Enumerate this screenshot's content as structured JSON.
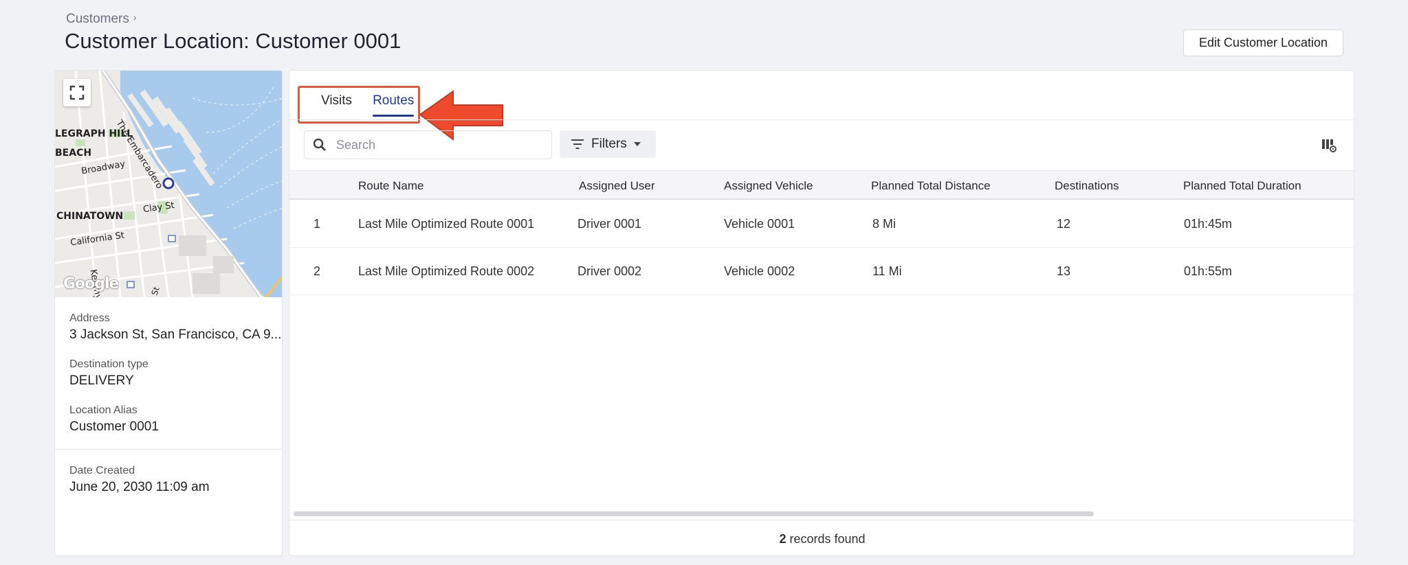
{
  "breadcrumb": {
    "parent": "Customers"
  },
  "page": {
    "title": "Customer Location: Customer 0001",
    "edit_button": "Edit Customer Location"
  },
  "map": {
    "labels": {
      "telegraph_hill": "LEGRAPH HILL",
      "beach": "BEACH",
      "broadway": "Broadway",
      "embarcadero": "The Embarcadero",
      "chinatown": "CHINATOWN",
      "clay_st": "Clay St",
      "california_st": "California St",
      "kearny": "Kearny",
      "st": "St"
    },
    "attribution": "Google",
    "water_color": "#a8cbed",
    "land_color": "#ecebe8"
  },
  "details": {
    "address_label": "Address",
    "address_value": "3 Jackson St, San Francisco, CA 9...",
    "type_label": "Destination type",
    "type_value": "DELIVERY",
    "alias_label": "Location Alias",
    "alias_value": "Customer 0001",
    "created_label": "Date Created",
    "created_value": "June 20, 2030 11:09 am"
  },
  "tabs": [
    {
      "label": "Visits",
      "active": false
    },
    {
      "label": "Routes",
      "active": true
    }
  ],
  "toolbar": {
    "search_placeholder": "Search",
    "filters_label": "Filters"
  },
  "table": {
    "columns": [
      "Route Name",
      "Assigned User",
      "Assigned Vehicle",
      "Planned Total Distance",
      "Destinations",
      "Planned Total Duration"
    ],
    "rows": [
      [
        "1",
        "Last Mile Optimized Route 0001",
        "Driver 0001",
        "Vehicle 0001",
        "8 Mi",
        "12",
        "01h:45m"
      ],
      [
        "2",
        "Last Mile Optimized Route 0002",
        "Driver 0002",
        "Vehicle 0002",
        "11 Mi",
        "13",
        "01h:55m"
      ]
    ]
  },
  "footer": {
    "count": "2",
    "suffix": " records found"
  },
  "colors": {
    "accent": "#1f3a93",
    "highlight": "#e9553b"
  }
}
